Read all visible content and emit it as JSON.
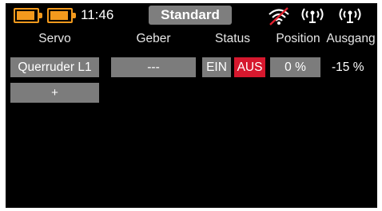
{
  "status_bar": {
    "clock": "11:46",
    "model_name": "Standard",
    "battery_color": "#f39a1d",
    "icons": [
      "battery-tx-icon",
      "battery-rx-icon",
      "wifi-off-icon",
      "antenna-signal-icon",
      "antenna-signal-icon"
    ]
  },
  "table": {
    "headers": {
      "servo": "Servo",
      "geber": "Geber",
      "status": "Status",
      "position": "Position",
      "ausgang": "Ausgang"
    },
    "rows": [
      {
        "servo": "Querruder L1",
        "geber": "---",
        "status_on": "EIN",
        "status_off": "AUS",
        "position": "0 %",
        "ausgang": "-15 %"
      }
    ],
    "add_label": "+"
  },
  "colors": {
    "background": "#000000",
    "button_gray": "#7c7c7c",
    "active_red": "#d6182e",
    "accent_orange": "#f39a1d"
  }
}
